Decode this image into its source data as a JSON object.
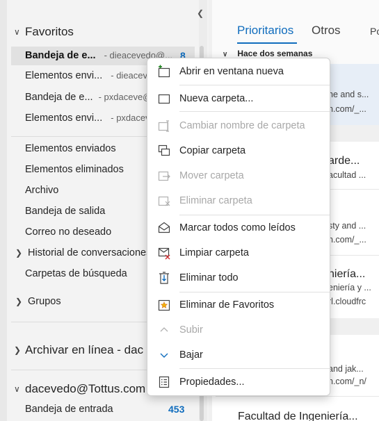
{
  "sidebar": {
    "favorites_label": "Favoritos",
    "favorites": [
      {
        "name": "Bandeja de e...",
        "account": "- dieacevedo@...",
        "count": "8"
      },
      {
        "name": "Elementos envi...",
        "account": "- dieacev"
      },
      {
        "name": "Bandeja de e...",
        "account": "- pxdaceve@"
      },
      {
        "name": "Elementos envi...",
        "account": "- pxdacev"
      }
    ],
    "folders": [
      "Elementos enviados",
      "Elementos eliminados",
      "Archivo",
      "Bandeja de salida",
      "Correo no deseado",
      "Historial de conversaciones",
      "Carpetas de búsqueda"
    ],
    "groups_label": "Grupos",
    "online_archive_label": "Archivar en línea - dac",
    "account_label": "dacevedo@Tottus.com",
    "inbox_label": "Bandeja de entrada",
    "inbox_count": "453"
  },
  "message_list": {
    "tabs": [
      "Prioritarios",
      "Otros",
      "Po"
    ],
    "group_header": "Hace dos semanas",
    "snippets": [
      "he and s...",
      "n.com/_...",
      "arde...",
      "acultad ...",
      "sty and ...",
      "n.com/_...",
      "niería...",
      "eniería y ...",
      "rl.cloudfrc",
      "and jak...",
      "n.com/_n/",
      "Facultad de Ingeniería..."
    ]
  },
  "context_menu": {
    "items": [
      {
        "label": "Abrir en ventana nueva",
        "icon": "open-new-window-icon",
        "enabled": true
      },
      {
        "label": "Nueva carpeta...",
        "icon": "new-folder-icon",
        "enabled": true
      },
      {
        "label": "Cambiar nombre de carpeta",
        "icon": "rename-folder-icon",
        "enabled": false
      },
      {
        "label": "Copiar carpeta",
        "icon": "copy-folder-icon",
        "enabled": true
      },
      {
        "label": "Mover carpeta",
        "icon": "move-folder-icon",
        "enabled": false
      },
      {
        "label": "Eliminar carpeta",
        "icon": "delete-folder-icon",
        "enabled": false
      },
      {
        "label": "Marcar todos como leídos",
        "icon": "mark-read-icon",
        "enabled": true
      },
      {
        "label": "Limpiar carpeta",
        "icon": "clean-folder-icon",
        "enabled": true
      },
      {
        "label": "Eliminar todo",
        "icon": "delete-all-icon",
        "enabled": true
      },
      {
        "label": "Eliminar de Favoritos",
        "icon": "favorite-star-icon",
        "enabled": true
      },
      {
        "label": "Subir",
        "icon": "chevron-up-icon",
        "enabled": false
      },
      {
        "label": "Bajar",
        "icon": "chevron-down-icon",
        "enabled": true
      },
      {
        "label": "Propiedades...",
        "icon": "properties-icon",
        "enabled": true
      }
    ]
  },
  "colors": {
    "accent": "#0f6cbd",
    "disabled_text": "#a8a8a8",
    "delete_red": "#d13438",
    "star_orange": "#d9822b",
    "add_green": "#107c10"
  }
}
